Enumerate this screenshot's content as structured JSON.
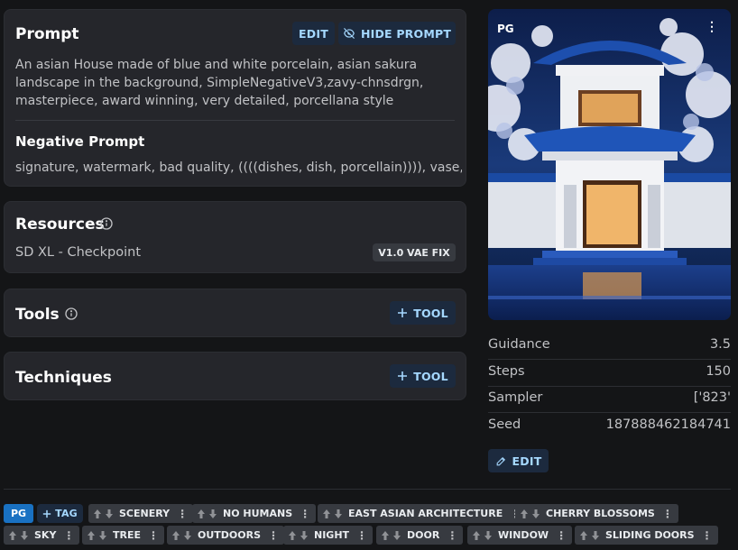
{
  "prompt_card": {
    "title": "Prompt",
    "edit_label": "EDIT",
    "hide_label": "HIDE PROMPT",
    "text": "An asian House made of blue and white porcelain, asian sakura landscape in the background, SimpleNegativeV3,zavy-chnsdrgn, masterpiece, award winning, very detailed, porcellana style",
    "negative_title": "Negative Prompt",
    "negative_text": "signature, watermark, bad quality, ((((dishes, dish, porcellain)))), vase,"
  },
  "resources_card": {
    "title": "Resources",
    "item_name": "SD XL - Checkpoint",
    "item_badge": "V1.0 VAE FIX"
  },
  "tools_card": {
    "title": "Tools",
    "add_label": "TOOL"
  },
  "techniques_card": {
    "title": "Techniques",
    "add_label": "TOOL"
  },
  "image": {
    "rating_badge": "PG"
  },
  "meta": {
    "guidance_label": "Guidance",
    "guidance_value": "3.5",
    "steps_label": "Steps",
    "steps_value": "150",
    "sampler_label": "Sampler",
    "sampler_value": "['823'",
    "seed_label": "Seed",
    "seed_value": "187888462184741",
    "edit_label": "EDIT"
  },
  "tags_bar": {
    "rating": "PG",
    "add_label": "TAG",
    "row1": [
      "SCENERY",
      "NO HUMANS",
      "EAST ASIAN ARCHITECTURE",
      "CHERRY BLOSSOMS"
    ],
    "row2": [
      "SKY",
      "TREE",
      "OUTDOORS",
      "NIGHT",
      "DOOR",
      "WINDOW",
      "SLIDING DOORS"
    ]
  },
  "colors": {
    "accent": "#a5d8ff",
    "button_bg": "#1c2a3e",
    "card_bg": "#25262b",
    "page_bg": "#141517",
    "rating_bg": "#1971c2"
  }
}
